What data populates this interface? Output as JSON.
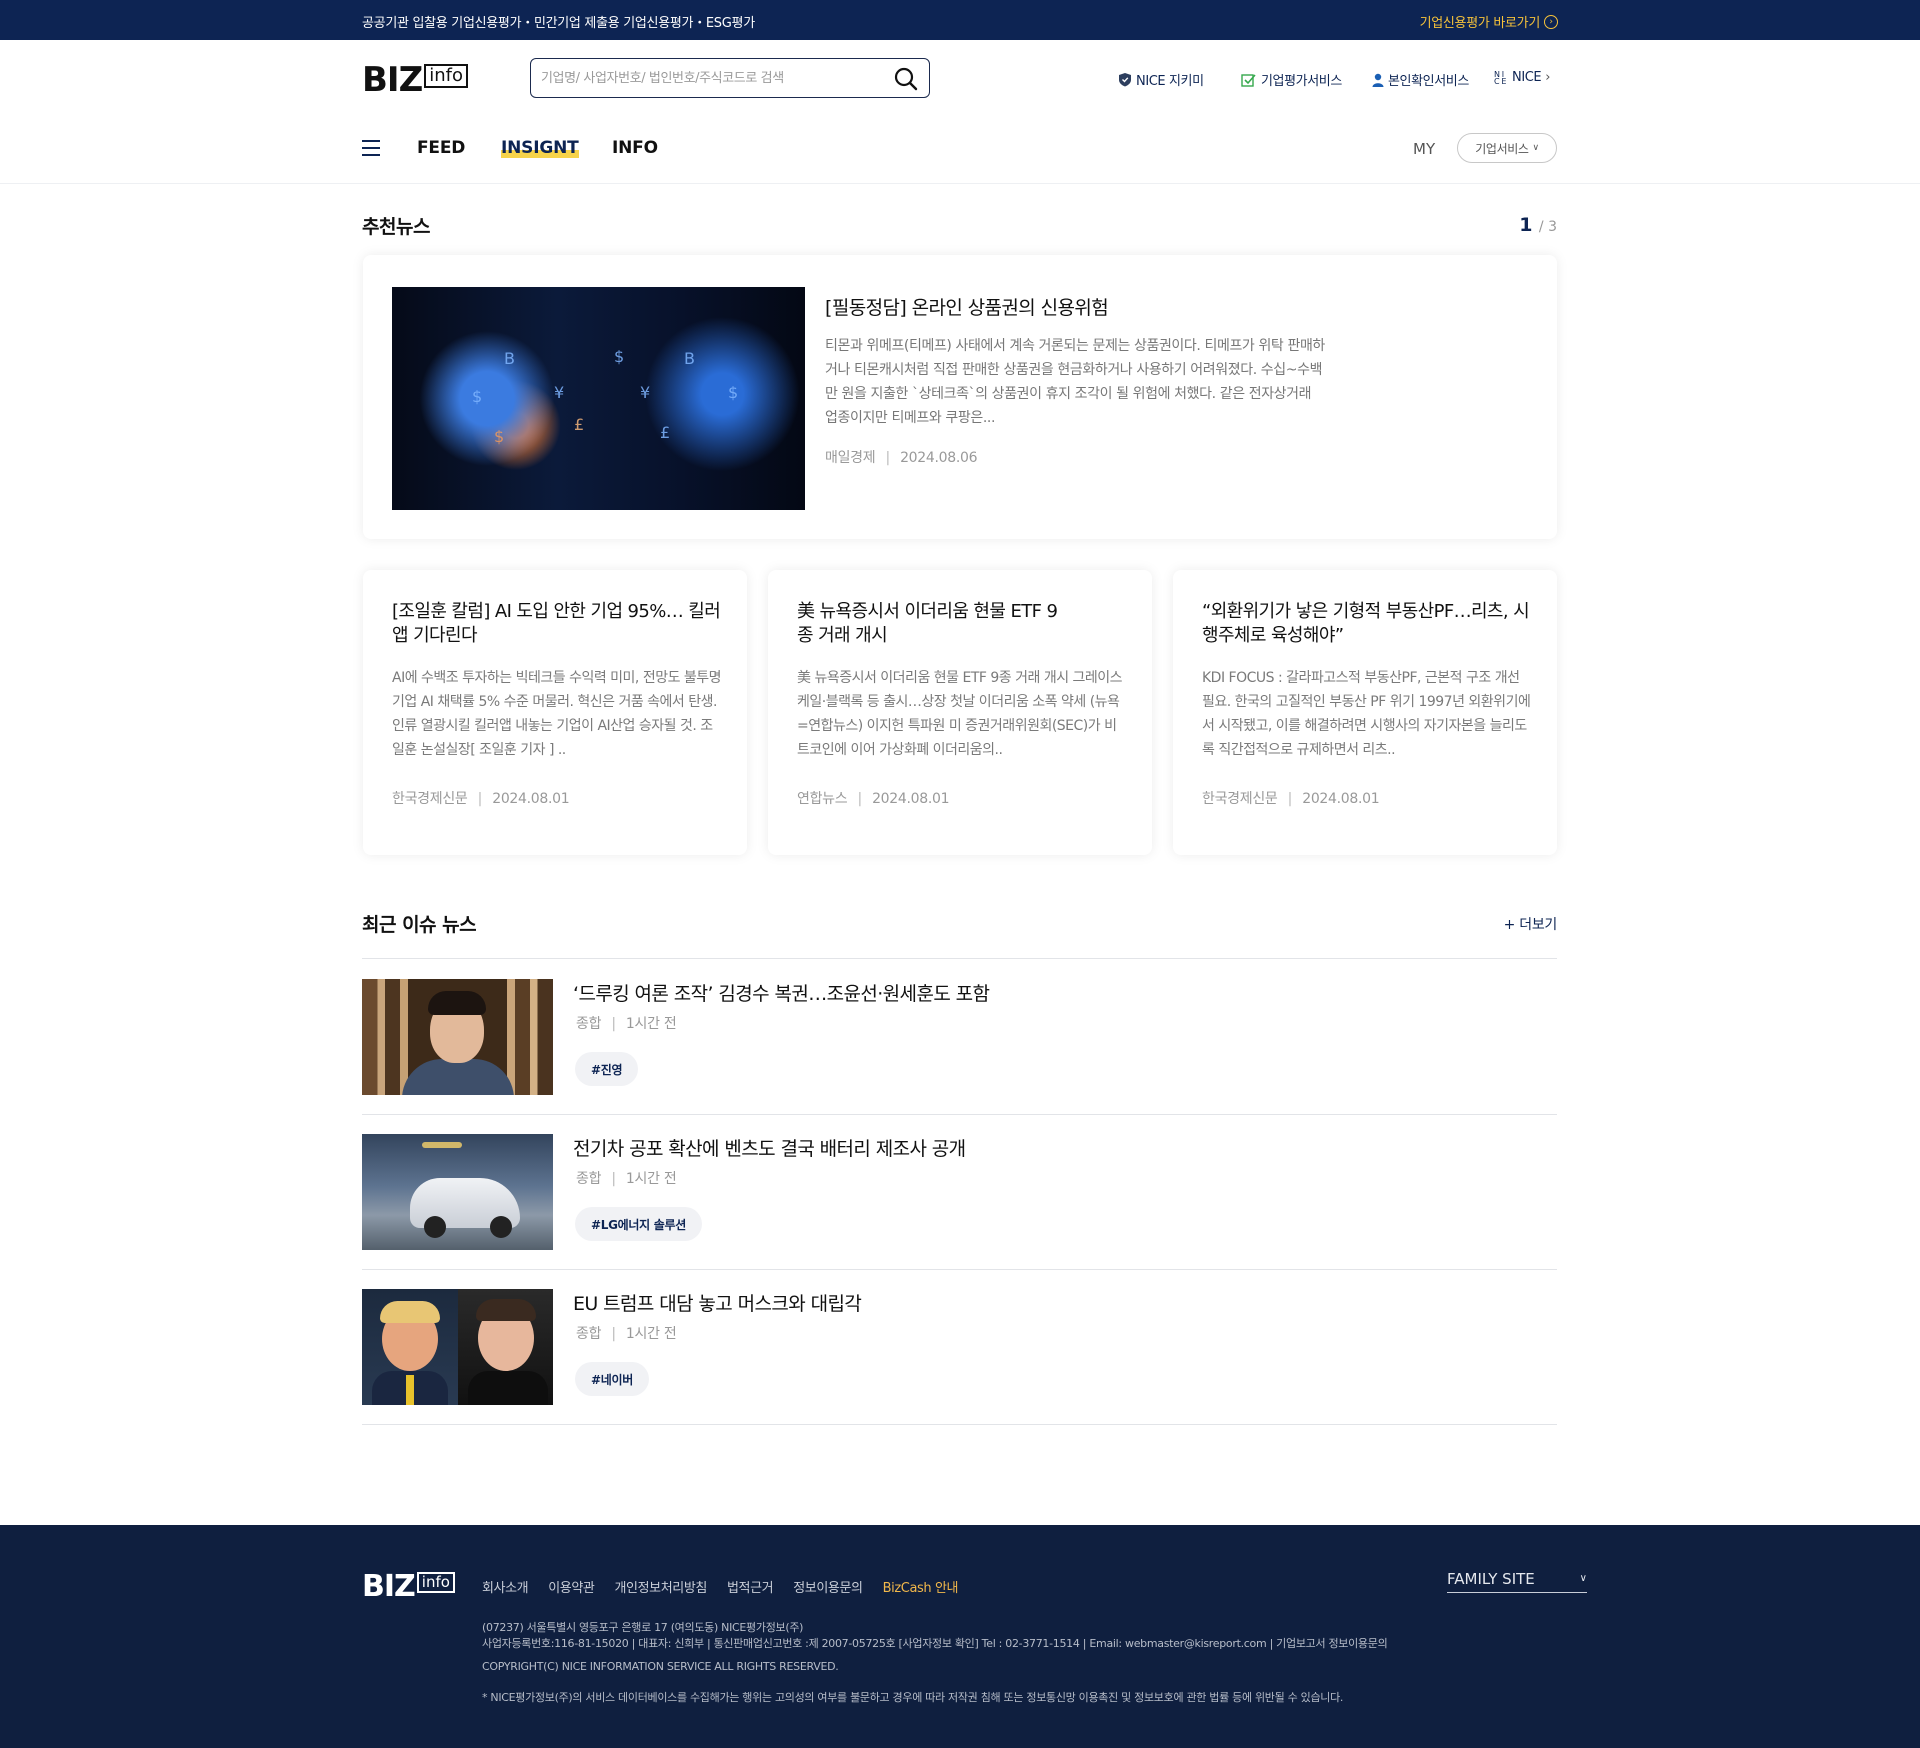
{
  "topbar": {
    "left_text": "공공기관 입찰용 기업신용평가・민간기업 제출용 기업신용평가・ESG평가",
    "right_link": "기업신용평가 바로가기"
  },
  "header": {
    "logo_biz": "BIZ",
    "logo_info": "info",
    "search_placeholder": "기업명/ 사업자번호/ 법인번호/주식코드로 검색",
    "utils": [
      "NICE 지키미",
      "기업평가서비스",
      "본인확인서비스",
      "NICE"
    ],
    "nav": [
      "FEED",
      "INSIGNT",
      "INFO"
    ],
    "active_nav": "INSIGNT",
    "my": "MY",
    "biz_service": "기업서비스"
  },
  "recommended": {
    "title": "추천뉴스",
    "page_current": "1",
    "page_total": "/ 3",
    "featured": {
      "title": "[필동정담] 온라인 상품권의 신용위험",
      "desc": "티몬과 위메프(티메프) 사태에서 계속 거론되는 문제는 상품권이다. 티메프가 위탁 판매하거나 티몬캐시처럼 직접 판매한 상품권을 현금화하거나 사용하기 어려워졌다. 수십~수백만 원을 지출한 `상테크족`의 상품권이 휴지 조각이 될 위험에 처했다. 같은 전자상거래 업종이지만 티메프와 쿠팡은...",
      "source": "매일경제",
      "date": "2024.08.06"
    },
    "cards": [
      {
        "title": "[조일훈 칼럼] AI 도입 안한 기업 95%… 킬러앱 기다린다",
        "desc": "AI에 수백조 투자하는 빅테크들 수익력 미미, 전망도 불투명 기업 AI 채택률 5% 수준 머물러. 혁신은 거품 속에서 탄생. 인류 열광시킬 킬러앱 내놓는 기업이 AI산업 승자될 것. 조일훈 논설실장[ 조일훈 기자 ] ..",
        "source": "한국경제신문",
        "date": "2024.08.01"
      },
      {
        "title": "美 뉴욕증시서 이더리움 현물 ETF 9종 거래 개시",
        "desc": "美 뉴욕증시서 이더리움 현물 ETF 9종 거래 개시 그레이스케일·블랙록 등 출시…상장 첫날 이더리움 소폭 약세 (뉴욕=연합뉴스) 이지헌 특파원 미 증권거래위원회(SEC)가 비트코인에 이어 가상화폐 이더리움의..",
        "source": "연합뉴스",
        "date": "2024.08.01"
      },
      {
        "title": "“외환위기가 낳은 기형적 부동산PF…리츠, 시행주체로 육성해야”",
        "desc": "KDI FOCUS : 갈라파고스적 부동산PF, 근본적 구조 개선 필요. 한국의 고질적인 부동산 PF 위기 1997년 외환위기에서 시작됐고, 이를 해결하려면 시행사의 자기자본을 늘리도록 직간접적으로 규제하면서 리츠..",
        "source": "한국경제신문",
        "date": "2024.08.01"
      }
    ]
  },
  "recent": {
    "title": "최근 이슈 뉴스",
    "more": "+ 더보기",
    "items": [
      {
        "title": "‘드루킹 여론 조작’ 김경수 복권…조윤선·원세훈도 포함",
        "category": "종합",
        "time": "1시간 전",
        "tag": "#진영"
      },
      {
        "title": "전기차 공포 확산에 벤츠도 결국 배터리 제조사 공개",
        "category": "종합",
        "time": "1시간 전",
        "tag": "#LG에너지 솔루션"
      },
      {
        "title": "EU 트럼프 대담 놓고 머스크와 대립각",
        "category": "종합",
        "time": "1시간 전",
        "tag": "#네이버"
      }
    ]
  },
  "footer": {
    "links": [
      "회사소개",
      "이용약관",
      "개인정보처리방침",
      "법적근거",
      "정보이용문의",
      "BizCash 안내"
    ],
    "family_site": "FAMILY SITE",
    "address": "(07237) 서울특별시 영등포구 은행로 17 (여의도동) NICE평가정보(주)",
    "business": "사업자등록번호:116-81-15020 | 대표자: 신희부 | 통신판매업신고번호 :제 2007-05725호 [사업자정보 확인] Tel : 02-3771-1514 | Email: webmaster@kisreport.com | 기업보고서 정보이용문의",
    "copyright": "COPYRIGHT(C) NICE INFORMATION SERVICE ALL RIGHTS RESERVED.",
    "notice": "* NICE평가정보(주)의 서비스 데이터베이스를 수집해가는 행위는 고의성의 여부를 불문하고 경우에 따라 저작권 침해 또는 정보통신망 이용촉진 및 정보보호에 관한 법률 등에 위반될 수 있습니다."
  },
  "colors": {
    "navy": "#0d2453",
    "gold": "#f6c23a",
    "footer_bg": "#0f1f3f"
  }
}
